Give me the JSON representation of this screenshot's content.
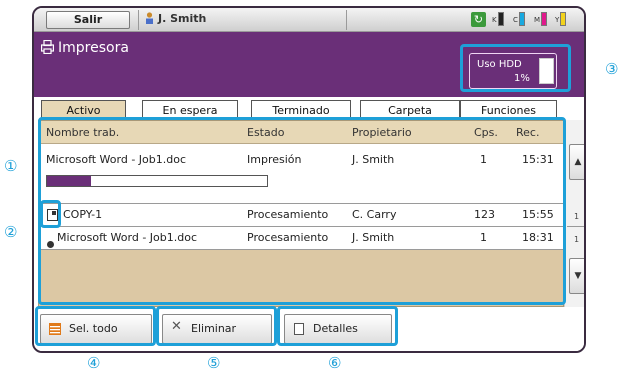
{
  "topbar": {
    "logout_label": "Salir",
    "user_name": "J. Smith",
    "toner_labels": [
      "K",
      "C",
      "M",
      "Y"
    ]
  },
  "header": {
    "title": "Impresora",
    "hdd_label": "Uso HDD",
    "hdd_percent": "1%"
  },
  "tabs": [
    {
      "label": "Activo"
    },
    {
      "label": "En espera"
    },
    {
      "label": "Terminado"
    },
    {
      "label": "Carpeta"
    },
    {
      "label": "Funciones"
    }
  ],
  "columns": {
    "name": "Nombre trab.",
    "status": "Estado",
    "owner": "Propietario",
    "copies": "Cps.",
    "received": "Rec."
  },
  "jobs": [
    {
      "name": "Microsoft Word - Job1.doc",
      "status": "Impresión",
      "owner": "J. Smith",
      "copies": "1",
      "time": "15:31",
      "progress": 0.2
    },
    {
      "name": "COPY-1",
      "status": "Procesamiento",
      "owner": "C. Carry",
      "copies": "123",
      "time": "15:55"
    },
    {
      "name": "Microsoft Word - Job1.doc",
      "status": "Procesamiento",
      "owner": "J. Smith",
      "copies": "1",
      "time": "18:31"
    }
  ],
  "scroll": {
    "row_markers": [
      "1",
      "1"
    ]
  },
  "bottom": {
    "select_all": "Sel. todo",
    "delete": "Eliminar",
    "details": "Detalles"
  },
  "callouts": [
    "①",
    "②",
    "③",
    "④",
    "⑤",
    "⑥"
  ],
  "colors": {
    "accent": "#6a2f78",
    "callout": "#1ea0d8",
    "list_bg": "#dcc8a4",
    "toner": {
      "K": "#222222",
      "C": "#19a9e0",
      "M": "#e0198c",
      "Y": "#f2d21c"
    }
  }
}
